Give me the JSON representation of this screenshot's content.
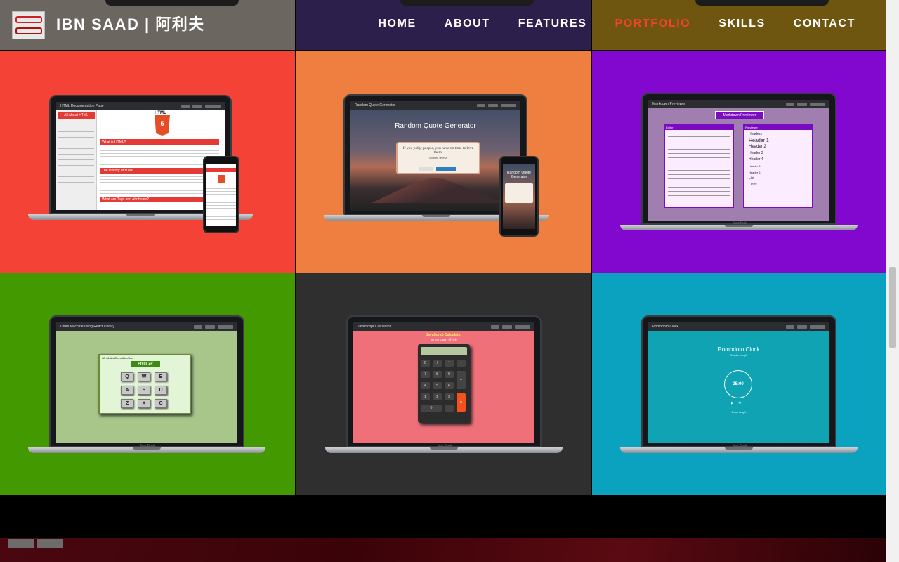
{
  "site": {
    "title": "IBN SAAD | 阿利夫"
  },
  "nav": {
    "items": [
      "HOME",
      "ABOUT",
      "FEATURES",
      "PORTFOLIO",
      "SKILLS",
      "CONTACT"
    ],
    "active": "PORTFOLIO"
  },
  "colors": {
    "accent": "#f04428",
    "top_tiles": [
      "#6b6660",
      "#2c1f4c",
      "#6f5610"
    ],
    "tiles": [
      "#f44336",
      "#ee7f40",
      "#8308cf",
      "#439a00",
      "#2f2f2f",
      "#0ba2c0"
    ]
  },
  "projects": [
    {
      "screen_title": "HTML Documentation Page",
      "heading": "All About HTML",
      "badge": "HTML",
      "section_1": "What is HTML?",
      "section_2": "The History of HTML",
      "section_3": "What are Tags and Attributes?"
    },
    {
      "screen_title": "Random Quote Generator",
      "heading": "Random Quote Generator",
      "quote": "If you judge people, you have no time to love them.",
      "author": "Mother Teresa"
    },
    {
      "screen_title": "Markdown Previewer",
      "heading": "Markdown Previewer",
      "pane_1": "Editor",
      "pane_2": "Previewer",
      "preview_lines": [
        "Headers",
        "Header 1",
        "Header 2",
        "Header 3",
        "Header 4",
        "Header 5",
        "Header 6",
        "List",
        "Links"
      ]
    },
    {
      "screen_title": "Drum Machine using React Library",
      "heading": "3D Model Drum Machine",
      "display": "Press 2P",
      "keys": [
        "Q",
        "W",
        "E",
        "A",
        "S",
        "D",
        "Z",
        "X",
        "C"
      ]
    },
    {
      "screen_title": "JavaScript Calculator",
      "heading": "JavaScript Calculator",
      "subtitle": "By Ibn Saad | 阿利夫",
      "keys": [
        "C",
        "/",
        "*",
        "-",
        "7",
        "8",
        "9",
        "+",
        "4",
        "5",
        "6",
        "1",
        "2",
        "3",
        "=",
        "0",
        "."
      ]
    },
    {
      "screen_title": "Pomodoro Clock",
      "heading": "Pomodoro Clock",
      "time": "25:00",
      "session_label": "Session Length",
      "break_label": "Break Length"
    }
  ],
  "device": {
    "brand": "MacBook"
  }
}
